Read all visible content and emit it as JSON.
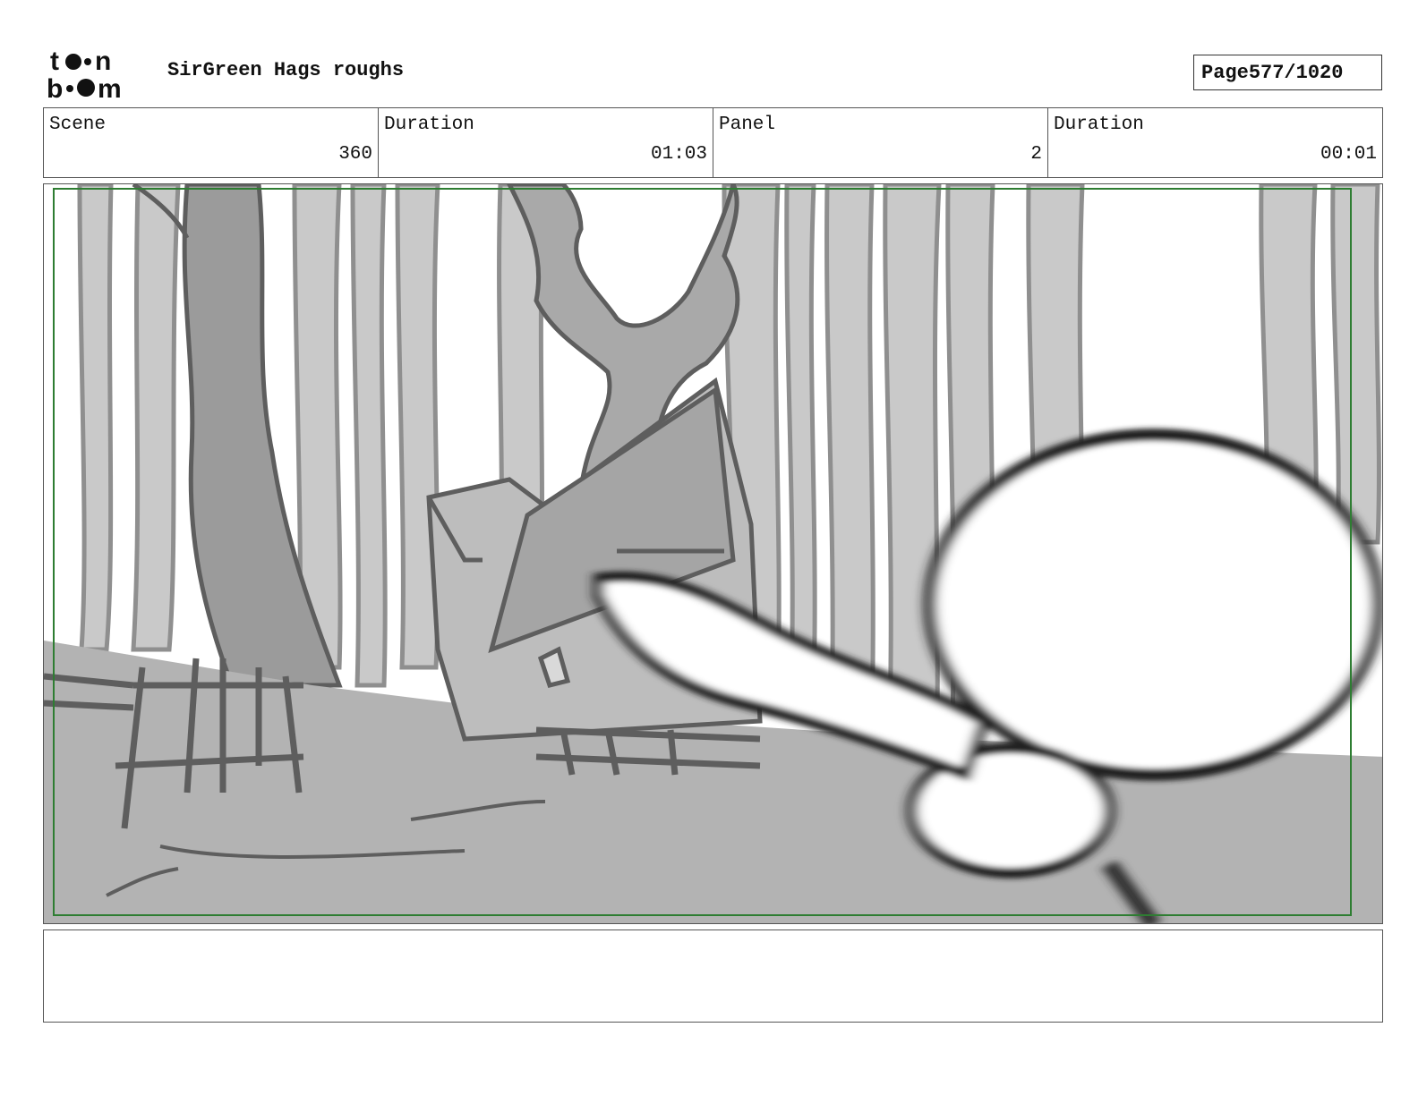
{
  "logo": {
    "line1": "toon",
    "line2": "boom"
  },
  "header": {
    "title": "SirGreen Hags roughs",
    "page_label": "Page",
    "page_value": "577/1020"
  },
  "info": {
    "scene_label": "Scene",
    "scene_value": "360",
    "duration_label": "Duration",
    "duration_value": "01:03",
    "panel_label": "Panel",
    "panel_value": "2",
    "panel_duration_label": "Duration",
    "panel_duration_value": "00:01"
  },
  "panel": {
    "safe_frame_color": "#2e7d32",
    "sky_color": "#ffffff",
    "tree_color": "#c9c9c9",
    "line_color": "#5e5e5e",
    "ground_color": "#b3b3b3"
  },
  "notes": {
    "text": ""
  }
}
